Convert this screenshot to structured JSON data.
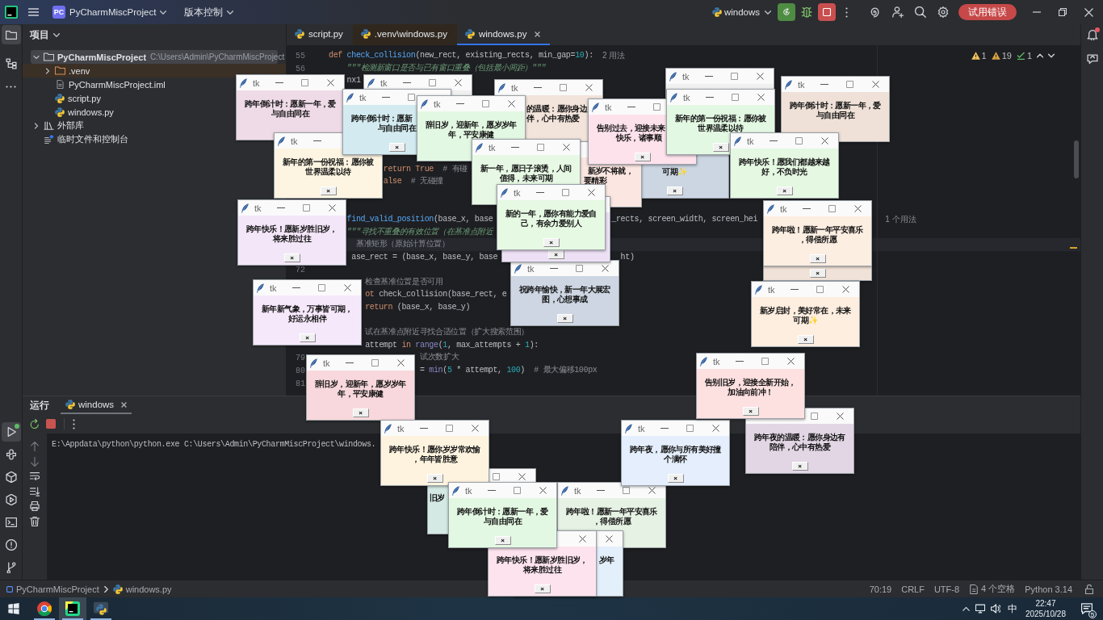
{
  "title_bar": {
    "project": {
      "badge": "PC",
      "name": "PyCharmMiscProject"
    },
    "vcs_menu": "版本控制",
    "run_config": "windows",
    "trial_button": "试用错误"
  },
  "left_toolbar": {
    "top": [
      {
        "kind": "project",
        "selected": true
      },
      {
        "kind": "structure",
        "selected": false
      },
      {
        "kind": "more",
        "selected": false
      }
    ],
    "bottom": [
      {
        "kind": "run",
        "selected": true,
        "running": true
      },
      {
        "kind": "python_console",
        "selected": false,
        "running": false
      },
      {
        "kind": "packages",
        "selected": false,
        "running": false
      },
      {
        "kind": "services",
        "selected": false,
        "running": false
      },
      {
        "kind": "terminal",
        "selected": false,
        "running": false
      },
      {
        "kind": "problems",
        "selected": false,
        "running": false
      },
      {
        "kind": "vcs",
        "selected": false,
        "running": false
      }
    ]
  },
  "right_toolbar": [
    {
      "kind": "notifications",
      "badge": true
    },
    {
      "kind": "ai_chat",
      "badge": false
    }
  ],
  "project_panel": {
    "title": "项目",
    "tree": [
      {
        "label": "PyCharmMiscProject",
        "path": "C:\\Users\\Admin\\PyCharmMiscProject",
        "kind": "folder",
        "expanded": true,
        "selected": true,
        "children": [
          {
            "label": ".venv",
            "kind": "excluded_folder",
            "expanded": false,
            "selected": false
          },
          {
            "label": "PyCharmMiscProject.iml",
            "kind": "module_file",
            "selected": false
          },
          {
            "label": "script.py",
            "kind": "python",
            "selected": false
          },
          {
            "label": "windows.py",
            "kind": "python",
            "selected": false
          }
        ]
      },
      {
        "label": "外部库",
        "kind": "library",
        "expanded": false,
        "selected": false
      },
      {
        "label": "临时文件和控制台",
        "kind": "scratch",
        "selected": false
      }
    ]
  },
  "editor": {
    "tabs": [
      {
        "label": "script.py",
        "kind": "project",
        "selected": false
      },
      {
        "label": ".venv\\windows.py",
        "kind": "external",
        "selected": false
      },
      {
        "label": "windows.py",
        "kind": "project",
        "selected": true
      }
    ],
    "inspections": [
      {
        "kind": "warning",
        "count": "1"
      },
      {
        "kind": "weak_warning",
        "count": "19"
      },
      {
        "kind": "typo",
        "count": "1"
      }
    ],
    "lines": [
      {
        "number": "55",
        "current": false,
        "fragments": [
          {
            "kind": "code",
            "tokens": [
              {
                "text": "def",
                "kind": "keyword"
              },
              {
                "text": " check_collision",
                "kind": "function"
              },
              {
                "text": "(new_rect, existing_rects, min_gap=",
                "kind": "plain"
              },
              {
                "text": "10",
                "kind": "number"
              },
              {
                "text": "):",
                "kind": "plain"
              }
            ]
          },
          {
            "kind": "hint",
            "text": "2 用法"
          }
        ]
      },
      {
        "number": "56",
        "current": false,
        "fragments": [
          {
            "kind": "code",
            "tokens": [
              {
                "text": "\"\"\"检测新窗口是否与已有窗口重叠（包括最小间距）\"\"\"",
                "kind": "docstring"
              }
            ]
          }
        ]
      },
      {
        "current": false,
        "fragments": [
          {
            "kind": "code",
            "tokens": [
              {
                "text": "nx1",
                "kind": "plain"
              }
            ]
          }
        ]
      },
      {
        "current": false,
        "fragments": [
          {
            "kind": "code",
            "tokens": [
              {
                "text": "return True",
                "kind": "keyword"
              },
              {
                "text": "  # 有碰",
                "kind": "comment"
              }
            ]
          }
        ]
      },
      {
        "current": false,
        "fragments": [
          {
            "kind": "code",
            "tokens": [
              {
                "text": "alse",
                "kind": "keyword"
              },
              {
                "text": "  # 无碰撞",
                "kind": "comment"
              }
            ]
          }
        ]
      },
      {
        "current": false,
        "fragments": [
          {
            "kind": "code",
            "tokens": [
              {
                "text": "find_valid_position",
                "kind": "function"
              },
              {
                "text": "(base_x, base",
                "kind": "plain"
              }
            ]
          },
          {
            "kind": "code",
            "tokens": [
              {
                "text": "_rects, screen_width, screen_hei",
                "kind": "plain"
              }
            ]
          },
          {
            "kind": "hint",
            "text": "1 个用法"
          }
        ]
      },
      {
        "current": false,
        "fragments": [
          {
            "kind": "code",
            "tokens": [
              {
                "text": "\"\"\"寻找不重叠的有效位置（在基准点附近",
                "kind": "docstring"
              }
            ]
          }
        ]
      },
      {
        "current": true,
        "fragments": [
          {
            "kind": "code",
            "tokens": [
              {
                "text": "基准矩形（原始计算位置）",
                "kind": "comment"
              }
            ]
          }
        ]
      },
      {
        "current": false,
        "fragments": [
          {
            "kind": "code",
            "tokens": [
              {
                "text": "ase_rect = (base_x, base_y, base",
                "kind": "plain"
              }
            ]
          },
          {
            "kind": "code",
            "tokens": [
              {
                "text": "ht)",
                "kind": "plain"
              }
            ]
          }
        ]
      },
      {
        "number": "72",
        "current": false
      },
      {
        "current": false,
        "fragments": [
          {
            "kind": "code",
            "tokens": [
              {
                "text": "检查基准位置是否可用",
                "kind": "comment"
              }
            ]
          }
        ]
      },
      {
        "current": false,
        "fragments": [
          {
            "kind": "code",
            "tokens": [
              {
                "text": "ot",
                "kind": "keyword"
              },
              {
                "text": " check_collision(base_rect, e",
                "kind": "plain"
              }
            ]
          }
        ]
      },
      {
        "current": false,
        "fragments": [
          {
            "kind": "code",
            "tokens": [
              {
                "text": "return",
                "kind": "keyword"
              },
              {
                "text": " (base_x, base_y)",
                "kind": "plain"
              }
            ]
          }
        ]
      },
      {
        "current": false,
        "fragments": [
          {
            "kind": "code",
            "tokens": [
              {
                "text": "试在基准点附近寻找合适位置（扩大搜索范围）",
                "kind": "comment"
              }
            ]
          }
        ]
      },
      {
        "current": false,
        "fragments": [
          {
            "kind": "code",
            "tokens": [
              {
                "text": "attempt ",
                "kind": "plain"
              },
              {
                "text": "in",
                "kind": "keyword"
              },
              {
                "text": " range",
                "kind": "builtin"
              },
              {
                "text": "(",
                "kind": "plain"
              },
              {
                "text": "1",
                "kind": "number"
              },
              {
                "text": ", max_attempts + ",
                "kind": "plain"
              },
              {
                "text": "1",
                "kind": "number"
              },
              {
                "text": "):",
                "kind": "plain"
              }
            ]
          }
        ]
      },
      {
        "number": "79",
        "current": false,
        "fragments": [
          {
            "kind": "code",
            "tokens": [
              {
                "text": "试次数扩大",
                "kind": "comment"
              }
            ]
          }
        ]
      },
      {
        "number": "80",
        "current": false,
        "fragments": [
          {
            "kind": "code",
            "tokens": [
              {
                "text": "= ",
                "kind": "plain"
              },
              {
                "text": "min",
                "kind": "builtin"
              },
              {
                "text": "(",
                "kind": "plain"
              },
              {
                "text": "5",
                "kind": "number"
              },
              {
                "text": " * attempt, ",
                "kind": "plain"
              },
              {
                "text": "100",
                "kind": "number"
              },
              {
                "text": ")  ",
                "kind": "plain"
              },
              {
                "text": "# 最大偏移100px",
                "kind": "comment"
              }
            ]
          }
        ]
      },
      {
        "number": "81",
        "current": false
      }
    ]
  },
  "run_panel": {
    "title": "运行",
    "tabs": [
      {
        "label": "windows",
        "selected": true
      }
    ],
    "output": "E:\\Appdata\\python\\python.exe C:\\Users\\Admin\\PyCharmMiscProject\\windows."
  },
  "status_bar": {
    "breadcrumbs": [
      {
        "label": "PyCharmMiscProject",
        "kind": "project"
      },
      {
        "label": "windows.py",
        "kind": "python"
      }
    ],
    "position": "70:19",
    "line_ending": "CRLF",
    "encoding": "UTF-8",
    "indent": "4 个空格",
    "interpreter": "Python 3.14"
  },
  "taskbar": {
    "apps": [
      {
        "kind": "chrome",
        "selected": false,
        "running": true
      },
      {
        "kind": "pycharm",
        "selected": true,
        "running": true
      },
      {
        "kind": "python",
        "selected": false,
        "running": true
      }
    ],
    "ime": "中",
    "time": "22:47",
    "date": "2025/10/28",
    "notifications": "5"
  },
  "popups": [
    {
      "title": "tk",
      "lines": [
        "跨年倒计时：愿新一年，爱",
        "与自由同在"
      ],
      "color": "#efdbe7"
    },
    {
      "title": "tk"
    },
    {
      "title": "tk",
      "lines": [
        "跨年倒计时：愿新",
        "与自由同在"
      ],
      "button": "×",
      "color": "#d3ebf0"
    },
    {
      "title": "tk",
      "lines": [
        "辞旧岁，迎新年，愿岁岁年",
        "年，平安康健"
      ],
      "color": "#e3f8e2"
    },
    {
      "title": "tk",
      "lines": [
        "的温暖：愿你身边",
        "伴，心中有热爱"
      ],
      "color": "#f2e3db"
    },
    {
      "title": "tk",
      "lines": [
        "告别过去，迎接未来",
        "快乐，诸事顺"
      ],
      "button": "×",
      "color": "#fde2ec"
    },
    {
      "title": "tk"
    },
    {
      "title": "tk",
      "lines": [
        "新年的第一份祝福：愿你被",
        "世界温柔以待"
      ],
      "button": "×",
      "color": "#e3f8e3"
    },
    {
      "title": "tk",
      "lines": [
        "跨年倒计时：愿新一年，爱",
        "与自由同在"
      ],
      "color": "#f0e1d8"
    },
    {
      "title": "tk",
      "lines": [
        "新年的第一份祝福：愿你被",
        "世界温柔以待"
      ],
      "button": "×",
      "color": "#fdf5e2"
    },
    {
      "title": "tk",
      "lines": [
        "新一年，愿日子滚烫，人间",
        "值得，未来可期"
      ],
      "color": "#e7f9e4"
    },
    {
      "lines": [
        "新岁不将就，",
        "要精彩"
      ],
      "color": "#fbe6e1"
    },
    {
      "lines": [
        "可期✨"
      ],
      "button": "×",
      "color": "#ccd6e3"
    },
    {
      "title": "tk",
      "lines": [
        "跨年快乐！愿我们都越来越",
        "好，不负时光"
      ],
      "button": "×",
      "color": "#e5f8e2"
    },
    {
      "title": "tk",
      "lines": [
        "跨年快乐！愿新岁胜旧岁，",
        "将来胜过往"
      ],
      "button": "×",
      "color": "#f3e6f8"
    },
    {
      "title": "tk",
      "lines": [
        "新的一年，愿你有能力爱自",
        "己，有余力爱别人"
      ],
      "button": "×",
      "color": "#e6f9e3"
    },
    {
      "button": "×",
      "color": "#ede0f5"
    },
    {
      "title": "tk",
      "lines": [
        "跨年啦！愿新一年平安喜乐",
        "，得偿所愿"
      ],
      "button": "×",
      "color": "#fdeee2"
    },
    {
      "button": "×",
      "color": "#f0e2d8"
    },
    {
      "title": "tk",
      "lines": [
        "新年新气象，万事皆可期，",
        "好运永相伴"
      ],
      "button": "×",
      "color": "#f6e8fb"
    },
    {
      "title": "tk",
      "lines": [
        "祝跨年愉快，新一年大展宏",
        "图，心想事成"
      ],
      "button": "×",
      "color": "#cdd6e2"
    },
    {
      "title": "tk",
      "lines": [
        "新岁启封，美好常在，未来",
        "可期✨"
      ],
      "button": "×",
      "color": "#fdeee0"
    },
    {
      "title": "tk",
      "lines": [
        "辞旧岁，迎新年，愿岁岁年",
        "年，平安康健"
      ],
      "button": "×",
      "color": "#f8d8dc"
    },
    {
      "title": "tk",
      "lines": [
        "告别旧岁，迎接全新开始，",
        "加油向前冲！"
      ],
      "button": "×",
      "color": "#fde0e0"
    },
    {
      "title": "tk",
      "lines": [
        "跨年快乐！愿你岁岁常欢愉",
        "，年年皆胜意"
      ],
      "button": "×",
      "color": "#fdf3df"
    },
    {
      "title": "tk",
      "lines": [
        "跨年夜，愿你与所有美好撞",
        "个满怀"
      ],
      "button": "×",
      "color": "#e4eefc"
    },
    {
      "lines": [
        "跨年夜的温暖：愿你身边有",
        "陪伴，心中有热爱"
      ],
      "button": "×",
      "color": "#e2d6e5"
    },
    {
      "lines": [
        "旧岁"
      ],
      "color": "#d5e9e4"
    },
    {
      "title": "tk",
      "lines": [
        "跨年倒计时：愿新一年，爱",
        "与自由同在"
      ],
      "button": "×",
      "color": "#e3f8e2"
    },
    {
      "title": "tk",
      "lines": [
        "跨年啦！愿新一年平安喜乐",
        "，得偿所愿"
      ],
      "color": "#e6f2e4"
    },
    {
      "lines": [
        "跨年快乐！愿新岁胜旧岁，",
        "将来胜过往"
      ],
      "button": "×",
      "color": "#fde3ee"
    },
    {
      "lines": [
        "岁年"
      ],
      "color": "#e3effa"
    }
  ]
}
